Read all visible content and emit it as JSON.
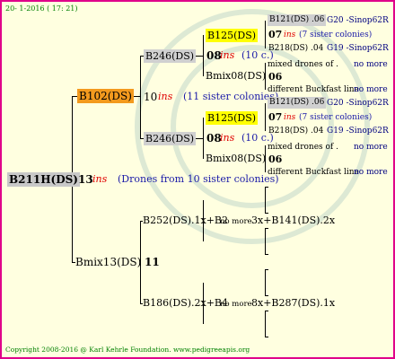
{
  "date": "20- 1-2016 ( 17: 21)",
  "footer": "Copyright 2008-2016 @ Karl Kehrle Foundation.  www.pedigreeapis.org",
  "colors": {
    "border": "#e0008a",
    "bg": "#ffffe0",
    "orange": "#f39a1e",
    "yellow": "#ffff00",
    "grey": "#c8c8c8",
    "red": "#e00000"
  },
  "root": {
    "label": "B211H(DS)",
    "num": "13",
    "ins": "ins",
    "note": "(Drones from 10 sister colonies)"
  },
  "q1": {
    "label": "B102(DS)",
    "num": "10",
    "ins": "ins",
    "note": "(11 sister colonies)"
  },
  "q1m": {
    "label": "Bmix13(DS)",
    "num": "11"
  },
  "g3a": {
    "label": "B246(DS)"
  },
  "g3b": {
    "label": "B246(DS)"
  },
  "g3c": {
    "label": "B252(DS).1x+B2",
    "more": "no more",
    "tail": "3x+B141(DS).2x"
  },
  "g3d": {
    "label": "B186(DS).2x+B4",
    "more": "no more",
    "tail": "8x+B287(DS).1x"
  },
  "a": {
    "q": "B125(DS)",
    "qnum": "08",
    "qins": "ins",
    "qnote": "(10 c.)",
    "m": "Bmix08(DS)",
    "mnum": "06",
    "r1": "B121(DS) .06",
    "r1b": "G20 -Sinop62R",
    "r2num": "07",
    "r2ins": "ins",
    "r2note": "(7 sister colonies)",
    "r3": "B218(DS) .04",
    "r3b": "G19 -Sinop62R",
    "r4": "mixed drones of .",
    "r4b": "no more",
    "r5": "different Buckfast line",
    "r5b": "no more"
  },
  "b": {
    "q": "B125(DS)",
    "qnum": "08",
    "qins": "ins",
    "qnote": "(10 c.)",
    "m": "Bmix08(DS)",
    "mnum": "06",
    "r1": "B121(DS) .06",
    "r1b": "G20 -Sinop62R",
    "r2num": "07",
    "r2ins": "ins",
    "r2note": "(7 sister colonies)",
    "r3": "B218(DS) .04",
    "r3b": "G19 -Sinop62R",
    "r4": "mixed drones of .",
    "r4b": "no more",
    "r5": "different Buckfast line",
    "r5b": "no more"
  }
}
